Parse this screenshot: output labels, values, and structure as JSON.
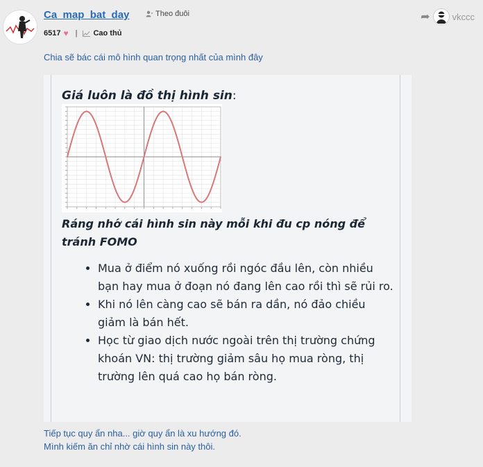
{
  "post": {
    "username": "Ca_map_bat_day",
    "follow_label": "Theo đuôi",
    "points": "6517",
    "rank": "Cao thủ",
    "reply_to_user": "vkccc",
    "intro_text": "Chia sẽ bác cái mô hình quan trọng nhất của mình đây",
    "outro_lines": [
      "Tiếp tục quy ẩn nha... giờ quy ẩn là xu hướng đó.",
      "Mình kiếm ăn chỉ nhờ cái hình sin này thôi."
    ]
  },
  "quote": {
    "title": "Giá luôn là đồ thị hình sin",
    "title_colon": ":",
    "subtitle": "Ráng nhớ cái hình sin này mỗi khi đu cp nóng để tránh FOMO",
    "bullets": [
      "Mua ở điểm nó xuống rồi ngóc đầu lên, còn nhiều bạn hay mua ở đoạn nó đang lên cao rồi thì sẽ rủi ro.",
      "Khi nó lên càng cao sẽ bán ra dần, nó đảo chiều giảm là bán hết.",
      "Học từ giao dịch nước ngoài trên thị trường chứng khoán VN: thị trường giảm sâu họ mua ròng, thị trường lên quá cao họ bán ròng."
    ]
  },
  "icons": {
    "follow": "user-icon",
    "heart": "heart-icon",
    "rank": "rank-chart-icon",
    "reply": "reply-arrow-icon"
  },
  "colors": {
    "link": "#2a6bb5",
    "text_blue": "#2a5f9e",
    "heart": "#e57390",
    "sine_curve": "#d8777a"
  },
  "chart_data": {
    "type": "line",
    "title": "",
    "xlabel": "",
    "ylabel": "",
    "x": [
      0,
      1.5708,
      3.1416,
      4.7124,
      6.2832,
      7.854,
      9.4248,
      10.9956,
      12.5664
    ],
    "series": [
      {
        "values": [
          0,
          1,
          0,
          -1,
          0,
          1,
          0,
          -1,
          0
        ]
      }
    ],
    "xlim": [
      0,
      12.5664
    ],
    "ylim": [
      -1.1,
      1.1
    ],
    "grid": true
  }
}
